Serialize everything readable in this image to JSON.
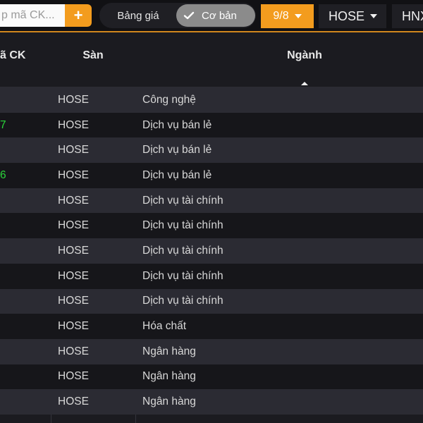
{
  "toolbar": {
    "search_placeholder": "p mã CK...",
    "add_label": "+",
    "view_toggle": {
      "option_a": "Bảng giá",
      "option_b": "Cơ bản",
      "active": "option_b"
    },
    "date_label": "9/8",
    "exchange_hose": "HOSE",
    "exchange_hnx": "HNX",
    "accent_color": "#f39c1e"
  },
  "table": {
    "headers": {
      "ma": "ã CK",
      "san": "Sàn",
      "nganh": "Ngành"
    },
    "sort": {
      "column": "nganh",
      "direction": "asc"
    },
    "rows": [
      {
        "ma": "",
        "san": "HOSE",
        "nganh": "Công nghệ"
      },
      {
        "ma": "7",
        "san": "HOSE",
        "nganh": "Dịch vụ bán lẻ"
      },
      {
        "ma": "",
        "san": "HOSE",
        "nganh": "Dịch vụ bán lẻ"
      },
      {
        "ma": "6",
        "san": "HOSE",
        "nganh": "Dịch vụ bán lẻ"
      },
      {
        "ma": "",
        "san": "HOSE",
        "nganh": "Dịch vụ tài chính"
      },
      {
        "ma": "",
        "san": "HOSE",
        "nganh": "Dịch vụ tài chính"
      },
      {
        "ma": "",
        "san": "HOSE",
        "nganh": "Dịch vụ tài chính"
      },
      {
        "ma": "",
        "san": "HOSE",
        "nganh": "Dịch vụ tài chính"
      },
      {
        "ma": "",
        "san": "HOSE",
        "nganh": "Dịch vụ tài chính"
      },
      {
        "ma": "",
        "san": "HOSE",
        "nganh": "Hóa chất"
      },
      {
        "ma": "",
        "san": "HOSE",
        "nganh": "Ngân hàng"
      },
      {
        "ma": "",
        "san": "HOSE",
        "nganh": "Ngân hàng"
      },
      {
        "ma": "",
        "san": "HOSE",
        "nganh": "Ngân hàng"
      }
    ]
  }
}
